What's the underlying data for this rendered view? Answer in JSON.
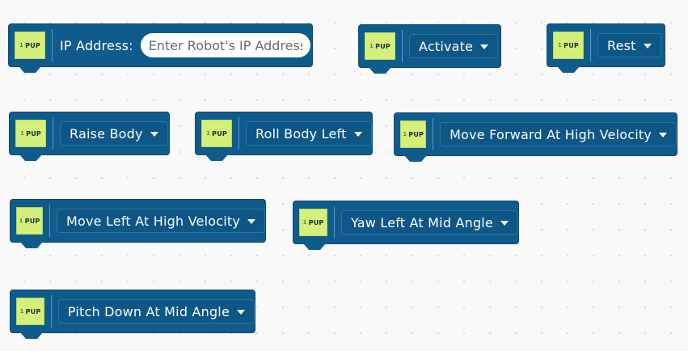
{
  "pup_badge": {
    "number": "1",
    "text": "PUP"
  },
  "blocks": {
    "ip_address": {
      "label": "IP Address:",
      "placeholder": "Enter Robot's IP Address"
    },
    "activate": {
      "value": "Activate"
    },
    "rest": {
      "value": "Rest"
    },
    "raise_body": {
      "value": "Raise Body"
    },
    "roll_body_left": {
      "value": "Roll Body Left"
    },
    "move_forward_high_velocity": {
      "value": "Move Forward At High Velocity"
    },
    "move_left_high_velocity": {
      "value": "Move Left At High Velocity"
    },
    "yaw_left_mid_angle": {
      "value": "Yaw Left At Mid Angle"
    },
    "pitch_down_mid_angle": {
      "value": "Pitch Down At Mid Angle"
    }
  },
  "colors": {
    "block_fill": "#0f5c8c",
    "badge_fill": "#d4f07a",
    "canvas_background": "#f9f9f9"
  },
  "icons": {
    "dropdown": "caret-down-icon"
  }
}
